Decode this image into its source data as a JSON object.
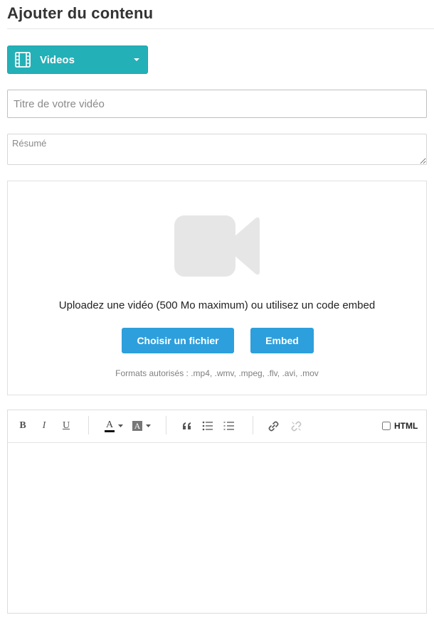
{
  "page": {
    "title": "Ajouter du contenu"
  },
  "type_select": {
    "selected": "Videos",
    "icon": "film-icon",
    "color": "#24b0b7"
  },
  "form": {
    "title_placeholder": "Titre de votre vidéo",
    "summary_placeholder": "Résumé"
  },
  "upload": {
    "icon": "video-camera-icon",
    "instruction": "Uploadez une vidéo (500 Mo maximum) ou utilisez un code embed",
    "choose_file_label": "Choisir un fichier",
    "embed_label": "Embed",
    "formats": "Formats autorisés : .mp4, .wmv, .mpeg, .flv, .avi, .mov",
    "button_color": "#2d9fdc"
  },
  "editor": {
    "toolbar": {
      "bold_label": "B",
      "italic_label": "I",
      "underline_label": "U",
      "font_color_label": "A",
      "highlight_label": "A",
      "html_toggle_label": "HTML",
      "html_checked": false
    },
    "content": ""
  }
}
